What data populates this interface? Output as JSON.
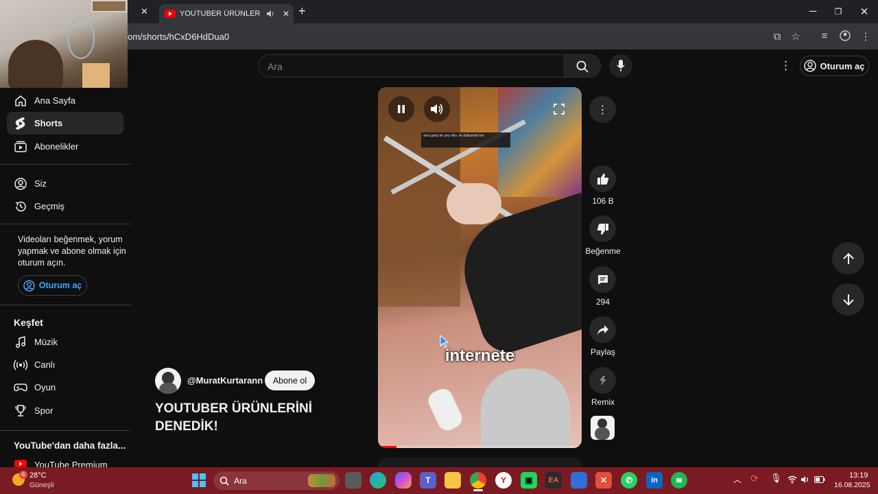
{
  "browser": {
    "tab_title": "YOUTUBER ÜRÜNLERİNİ DE",
    "url": "om/shorts/hCxD6HdDua0",
    "new_tab": "+",
    "tab_close": "✕"
  },
  "header": {
    "search_placeholder": "Ara",
    "signin_label": "Oturum aç"
  },
  "sidebar": {
    "items": [
      {
        "label": "Ana Sayfa",
        "icon": "home-icon"
      },
      {
        "label": "Shorts",
        "icon": "shorts-icon"
      },
      {
        "label": "Abonelikler",
        "icon": "subscriptions-icon"
      },
      {
        "label": "Siz",
        "icon": "person-icon"
      },
      {
        "label": "Geçmiş",
        "icon": "history-icon"
      }
    ],
    "signin_prompt": "Videoları beğenmek, yorum yapmak ve abone olmak için oturum açın.",
    "signin_label": "Oturum aç",
    "explore_title": "Keşfet",
    "explore_items": [
      {
        "label": "Müzik",
        "icon": "music-icon"
      },
      {
        "label": "Canlı",
        "icon": "live-icon"
      },
      {
        "label": "Oyun",
        "icon": "gaming-icon"
      },
      {
        "label": "Spor",
        "icon": "trophy-icon"
      }
    ],
    "more_title": "YouTube'dan daha fazla...",
    "premium_label": "YouTube Premium"
  },
  "video": {
    "caption_top": "ama garip bir şey oldu. ile dükkanda her",
    "caption_overlay": "internete",
    "channel": "@MuratKurtarann",
    "subscribe": "Abone ol",
    "title_line1": "YOUTUBER ÜRÜNLERİNİ",
    "title_line2": "DENEDİK!"
  },
  "actions": {
    "likes": "106 B",
    "dislike": "Beğenme",
    "comments": "294",
    "share": "Paylaş",
    "remix": "Remix"
  },
  "taskbar": {
    "weather_temp": "28°C",
    "weather_desc": "Güneşli",
    "weather_badge": "6",
    "search_label": "Ara",
    "time": "13:19",
    "date": "16.08.2025"
  },
  "colors": {
    "accent_blue": "#3ea6ff",
    "youtube_red": "#ff0000",
    "taskbar": "#7a1a22"
  }
}
